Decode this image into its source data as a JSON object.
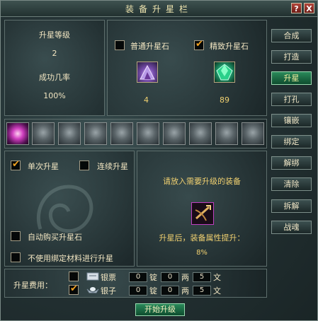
{
  "window": {
    "title": "装备升星栏",
    "help": "?",
    "close": "X"
  },
  "info": {
    "level_label": "升星等级",
    "level_value": "2",
    "rate_label": "成功几率",
    "rate_value": "100%"
  },
  "stones": {
    "normal": {
      "label": "普通升星石",
      "checked": false,
      "count": "4"
    },
    "refined": {
      "label": "精致升星石",
      "checked": true,
      "count": "89"
    }
  },
  "options": {
    "single_label": "单次升星",
    "single_checked": true,
    "continuous_label": "连续升星",
    "continuous_checked": false,
    "auto_buy_label": "自动购买升星石",
    "auto_buy_checked": false,
    "no_bound_label": "不使用绑定材料进行升星",
    "no_bound_checked": false
  },
  "equip": {
    "prompt": "请放入需要升级的装备",
    "after_label": "升星后，装备属性提升：",
    "boost": "8%"
  },
  "side_buttons": [
    "合成",
    "打造",
    "升星",
    "打孔",
    "镶嵌",
    "绑定",
    "解绑",
    "清除",
    "拆解",
    "战魂"
  ],
  "active_side": "升星",
  "cost": {
    "label": "升星费用：",
    "rows": [
      {
        "currency": "银票",
        "checked": false,
        "ding": "0",
        "liang": "0",
        "wen": "5",
        "u_ding": "锭",
        "u_liang": "两",
        "u_wen": "文"
      },
      {
        "currency": "银子",
        "checked": true,
        "ding": "0",
        "liang": "0",
        "wen": "5",
        "u_ding": "锭",
        "u_liang": "两",
        "u_wen": "文"
      }
    ]
  },
  "start_button": "开始升级",
  "colors": {
    "accent_green": "#2a8a5a",
    "check_orange": "#f0a020",
    "gold_text": "#f0d070"
  }
}
